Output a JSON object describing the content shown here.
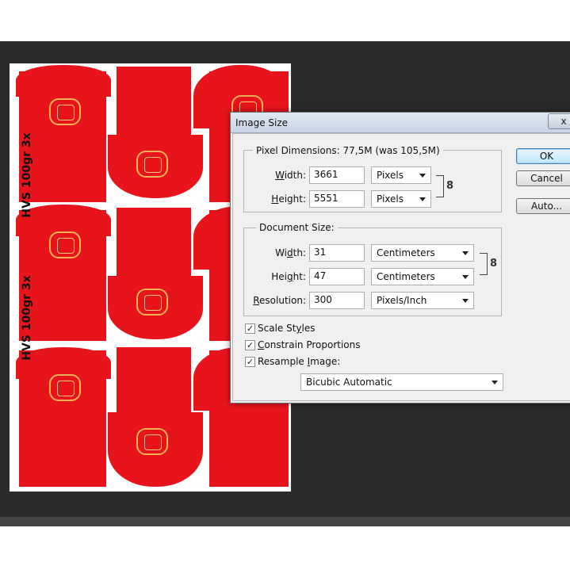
{
  "canvas": {
    "labels": [
      "HVS 100gr 3x",
      "HVS 100gr 3x"
    ]
  },
  "dialog": {
    "title": "Image Size",
    "close_glyph": "x",
    "pixel_dimensions": {
      "legend": "Pixel Dimensions:",
      "size_text": "77,5M (was 105,5M)",
      "width_label_u": "W",
      "width_label_rest": "idth:",
      "width_value": "3661",
      "width_unit": "Pixels",
      "height_label_u": "H",
      "height_label_rest": "eight:",
      "height_value": "5551",
      "height_unit": "Pixels"
    },
    "document_size": {
      "legend": "Document Size:",
      "width_label_pre": "Wi",
      "width_label_u": "d",
      "width_label_rest": "th:",
      "width_value": "31",
      "width_unit": "Centimeters",
      "height_label_pre": "Hei",
      "height_label_u": "g",
      "height_label_rest": "ht:",
      "height_value": "47",
      "height_unit": "Centimeters",
      "resolution_label_pre": "",
      "resolution_label_u": "R",
      "resolution_label_rest": "esolution:",
      "resolution_value": "300",
      "resolution_unit": "Pixels/Inch"
    },
    "options": {
      "scale_styles_pre": "Scale St",
      "scale_styles_u": "y",
      "scale_styles_rest": "les",
      "scale_styles_checked": true,
      "constrain_pre": "",
      "constrain_u": "C",
      "constrain_rest": "onstrain Proportions",
      "constrain_checked": true,
      "resample_pre": "Resample ",
      "resample_u": "I",
      "resample_rest": "mage:",
      "resample_checked": true,
      "resample_method": "Bicubic Automatic"
    },
    "buttons": {
      "ok": "OK",
      "cancel": "Cancel",
      "auto": "Auto..."
    },
    "check_glyph": "✓",
    "link_glyph": "8"
  }
}
